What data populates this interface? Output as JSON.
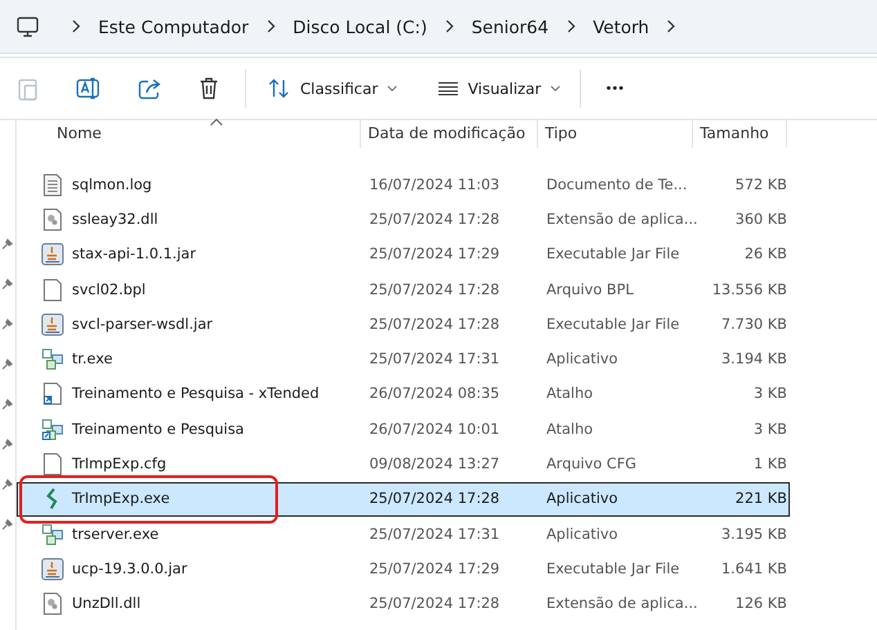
{
  "breadcrumb": [
    "Este Computador",
    "Disco Local (C:)",
    "Senior64",
    "Vetorh"
  ],
  "toolbar": {
    "sort_label": "Classificar",
    "view_label": "Visualizar",
    "more": "•••"
  },
  "table": {
    "columns": [
      "Nome",
      "Data de modificação",
      "Tipo",
      "Tamanho"
    ],
    "rows": [
      {
        "kind": "text",
        "name": "sqlmon.log",
        "date": "16/07/2024 11:03",
        "type": "Documento de Te...",
        "size": "572 KB",
        "selected": false,
        "highlighted": false
      },
      {
        "kind": "dll",
        "name": "ssleay32.dll",
        "date": "25/07/2024 17:28",
        "type": "Extensão de aplica...",
        "size": "360 KB",
        "selected": false,
        "highlighted": false
      },
      {
        "kind": "jar",
        "name": "stax-api-1.0.1.jar",
        "date": "25/07/2024 17:29",
        "type": "Executable Jar File",
        "size": "26 KB",
        "selected": false,
        "highlighted": false
      },
      {
        "kind": "blank",
        "name": "svcl02.bpl",
        "date": "25/07/2024 17:28",
        "type": "Arquivo BPL",
        "size": "13.556 KB",
        "selected": false,
        "highlighted": false
      },
      {
        "kind": "jar",
        "name": "svcl-parser-wsdl.jar",
        "date": "25/07/2024 17:28",
        "type": "Executable Jar File",
        "size": "7.730 KB",
        "selected": false,
        "highlighted": false
      },
      {
        "kind": "exe",
        "name": "tr.exe",
        "date": "25/07/2024 17:31",
        "type": "Aplicativo",
        "size": "3.194 KB",
        "selected": false,
        "highlighted": false
      },
      {
        "kind": "shortcut",
        "name": "Treinamento e Pesquisa - xTended",
        "date": "26/07/2024 08:35",
        "type": "Atalho",
        "size": "3 KB",
        "selected": false,
        "highlighted": false
      },
      {
        "kind": "exe-shortcut",
        "name": "Treinamento e Pesquisa",
        "date": "26/07/2024 10:01",
        "type": "Atalho",
        "size": "3 KB",
        "selected": false,
        "highlighted": false
      },
      {
        "kind": "blank",
        "name": "TrImpExp.cfg",
        "date": "09/08/2024 13:27",
        "type": "Arquivo CFG",
        "size": "1 KB",
        "selected": false,
        "highlighted": false
      },
      {
        "kind": "senior",
        "name": "TrImpExp.exe",
        "date": "25/07/2024 17:28",
        "type": "Aplicativo",
        "size": "221 KB",
        "selected": true,
        "highlighted": true
      },
      {
        "kind": "exe",
        "name": "trserver.exe",
        "date": "25/07/2024 17:31",
        "type": "Aplicativo",
        "size": "3.195 KB",
        "selected": false,
        "highlighted": false
      },
      {
        "kind": "jar",
        "name": "ucp-19.3.0.0.jar",
        "date": "25/07/2024 17:29",
        "type": "Executable Jar File",
        "size": "1.641 KB",
        "selected": false,
        "highlighted": false
      },
      {
        "kind": "dll",
        "name": "UnzDll.dll",
        "date": "25/07/2024 17:28",
        "type": "Extensão de aplica...",
        "size": "126 KB",
        "selected": false,
        "highlighted": false
      }
    ]
  }
}
